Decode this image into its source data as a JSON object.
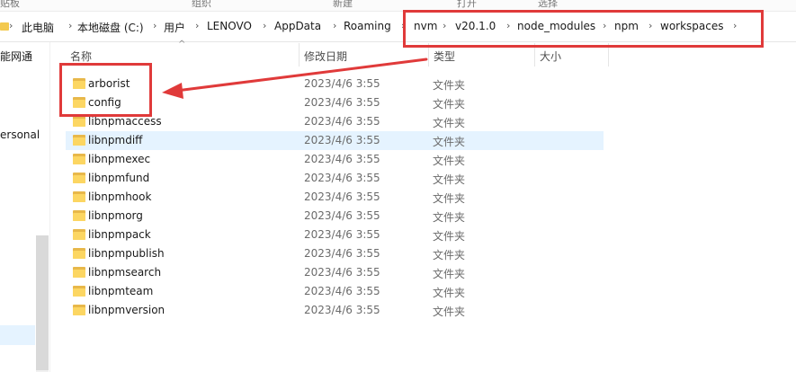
{
  "ribbon": {
    "left": "贴板",
    "mid1": "组织",
    "mid2": "新建",
    "mid3": "打开",
    "mid4": "选择"
  },
  "breadcrumb": [
    "此电脑",
    "本地磁盘 (C:)",
    "用户",
    "LENOVO",
    "AppData",
    "Roaming",
    "nvm",
    "v20.1.0",
    "node_modules",
    "npm",
    "workspaces"
  ],
  "nav": {
    "item1": "能网通",
    "item2": "ersonal"
  },
  "columns": {
    "name": "名称",
    "date": "修改日期",
    "type": "类型",
    "size": "大小"
  },
  "files": [
    {
      "name": "arborist",
      "date": "2023/4/6 3:55",
      "type": "文件夹"
    },
    {
      "name": "config",
      "date": "2023/4/6 3:55",
      "type": "文件夹"
    },
    {
      "name": "libnpmaccess",
      "date": "2023/4/6 3:55",
      "type": "文件夹"
    },
    {
      "name": "libnpmdiff",
      "date": "2023/4/6 3:55",
      "type": "文件夹"
    },
    {
      "name": "libnpmexec",
      "date": "2023/4/6 3:55",
      "type": "文件夹"
    },
    {
      "name": "libnpmfund",
      "date": "2023/4/6 3:55",
      "type": "文件夹"
    },
    {
      "name": "libnpmhook",
      "date": "2023/4/6 3:55",
      "type": "文件夹"
    },
    {
      "name": "libnpmorg",
      "date": "2023/4/6 3:55",
      "type": "文件夹"
    },
    {
      "name": "libnpmpack",
      "date": "2023/4/6 3:55",
      "type": "文件夹"
    },
    {
      "name": "libnpmpublish",
      "date": "2023/4/6 3:55",
      "type": "文件夹"
    },
    {
      "name": "libnpmsearch",
      "date": "2023/4/6 3:55",
      "type": "文件夹"
    },
    {
      "name": "libnpmteam",
      "date": "2023/4/6 3:55",
      "type": "文件夹"
    },
    {
      "name": "libnpmversion",
      "date": "2023/4/6 3:55",
      "type": "文件夹"
    }
  ],
  "colors": {
    "annotation": "#e03a3a",
    "hover_row": "#e5f3ff",
    "folder": "#fcd662"
  }
}
